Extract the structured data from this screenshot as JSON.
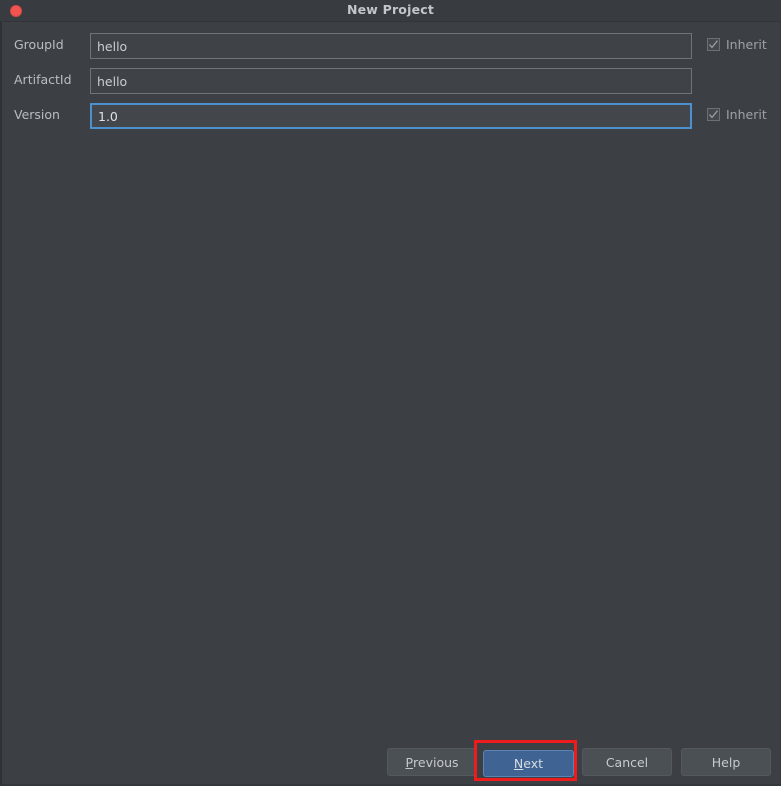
{
  "window": {
    "title": "New Project",
    "close_icon": "close-circle-icon",
    "accent_blue": "#4d90d0",
    "primary_button_blue": "#3f6493",
    "annotation_red": "#ee1c1c",
    "close_button_red": "#f2544f",
    "background": "#3c4044",
    "titlebar_background": "#383c40"
  },
  "form": {
    "rows": [
      {
        "label": "GroupId",
        "value": "hello",
        "placeholder": "",
        "focused": false,
        "inherit": {
          "label": "Inherit",
          "checked": true,
          "enabled": false
        }
      },
      {
        "label": "ArtifactId",
        "value": "hello",
        "placeholder": "",
        "focused": false,
        "inherit": null
      },
      {
        "label": "Version",
        "value": "1.0",
        "placeholder": "",
        "focused": true,
        "inherit": {
          "label": "Inherit",
          "checked": true,
          "enabled": false
        }
      }
    ]
  },
  "buttons": {
    "previous": {
      "label": "Previous",
      "mnemonic": "P",
      "rest": "revious",
      "primary": false
    },
    "next": {
      "label": "Next",
      "mnemonic": "N",
      "rest": "ext",
      "primary": true
    },
    "cancel": {
      "label": "Cancel",
      "mnemonic": "",
      "rest": "Cancel",
      "primary": false
    },
    "help": {
      "label": "Help",
      "mnemonic": "",
      "rest": "Help",
      "primary": false
    }
  }
}
